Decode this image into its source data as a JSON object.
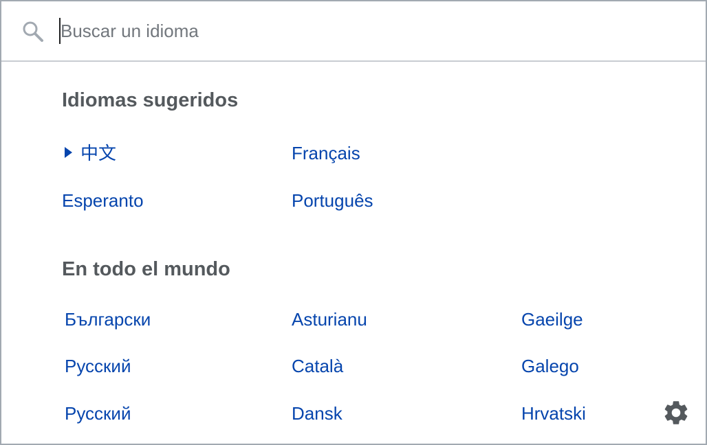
{
  "search": {
    "placeholder": "Buscar un idioma",
    "value": "",
    "icon": "search-icon"
  },
  "suggested": {
    "title": "Idiomas sugeridos",
    "items": [
      {
        "label": "中文",
        "selected": true
      },
      {
        "label": "Français",
        "selected": false
      },
      {
        "label": "Esperanto",
        "selected": false
      },
      {
        "label": "Português",
        "selected": false
      }
    ]
  },
  "worldwide": {
    "title": "En todo el mundo",
    "items": [
      {
        "label": "Български"
      },
      {
        "label": "Asturianu"
      },
      {
        "label": "Gaeilge"
      },
      {
        "label": "Русский"
      },
      {
        "label": "Català"
      },
      {
        "label": "Galego"
      },
      {
        "label": "Русский"
      },
      {
        "label": "Dansk"
      },
      {
        "label": "Hrvatski"
      }
    ]
  },
  "settings": {
    "icon": "gear-icon"
  },
  "colors": {
    "link": "#0645ad",
    "heading": "#54595d",
    "border": "#a2a9b1",
    "icon": "#54595d"
  }
}
